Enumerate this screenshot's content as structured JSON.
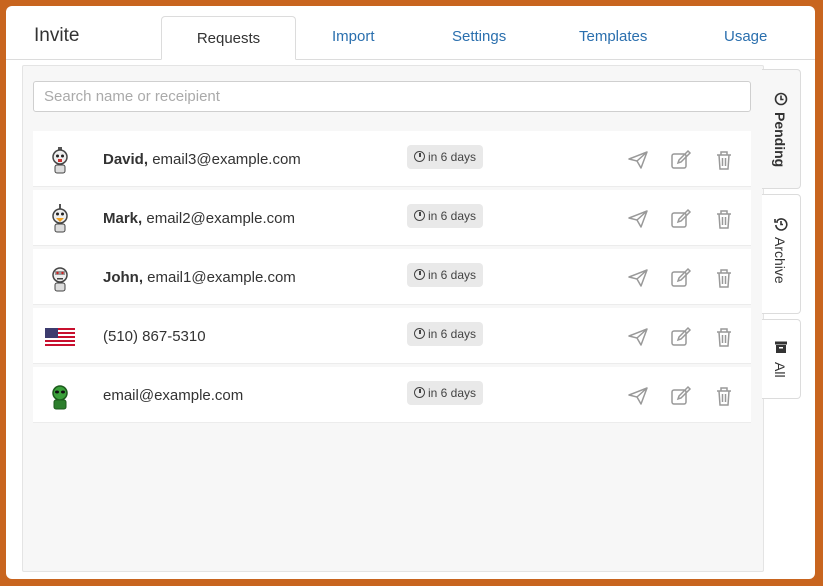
{
  "app": {
    "title": "Invite"
  },
  "tabs": [
    {
      "label": "Requests",
      "active": true
    },
    {
      "label": "Import"
    },
    {
      "label": "Settings"
    },
    {
      "label": "Templates"
    },
    {
      "label": "Usage"
    }
  ],
  "search": {
    "placeholder": "Search name or receipient",
    "value": ""
  },
  "rows": [
    {
      "name": "David,",
      "contact": "email3@example.com",
      "avatar": "robot-avatar-icon",
      "due": "in 6 days"
    },
    {
      "name": "Mark,",
      "contact": "email2@example.com",
      "avatar": "robot-avatar-icon",
      "due": "in 6 days"
    },
    {
      "name": "John,",
      "contact": "email1@example.com",
      "avatar": "robot-avatar-icon",
      "due": "in 6 days"
    },
    {
      "name": "",
      "contact": "(510) 867-5310",
      "avatar": "us-flag-icon",
      "due": "in 6 days"
    },
    {
      "name": "",
      "contact": "email@example.com",
      "avatar": "alien-avatar-icon",
      "due": "in 6 days"
    }
  ],
  "side_tabs": [
    {
      "label": "Pending",
      "icon": "clock-icon",
      "active": true
    },
    {
      "label": "Archive",
      "icon": "history-icon"
    },
    {
      "label": "All",
      "icon": "archive-box-icon"
    }
  ],
  "colors": {
    "accent": "#2a6fae",
    "frame": "#c8651f"
  }
}
